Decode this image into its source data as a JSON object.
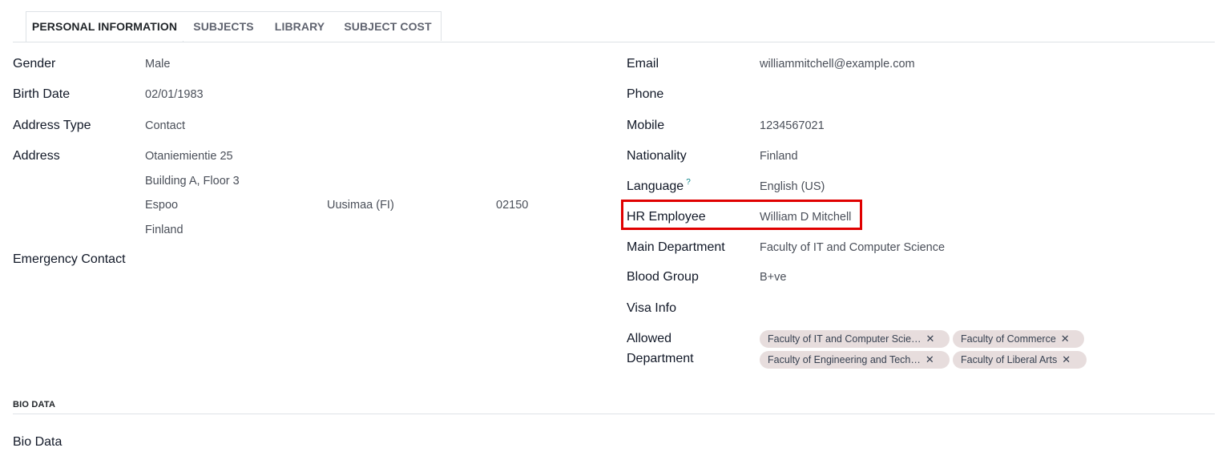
{
  "tabs": [
    {
      "label": "PERSONAL INFORMATION"
    },
    {
      "label": "SUBJECTS"
    },
    {
      "label": "LIBRARY"
    },
    {
      "label": "SUBJECT COST"
    }
  ],
  "left_fields": {
    "gender": {
      "label": "Gender",
      "value": "Male"
    },
    "birth_date": {
      "label": "Birth Date",
      "value": "02/01/1983"
    },
    "address_type": {
      "label": "Address Type",
      "value": "Contact"
    },
    "address": {
      "label": "Address",
      "street": "Otaniemientie 25",
      "street2": "Building A, Floor 3",
      "city": "Espoo",
      "state": "Uusimaa (FI)",
      "zip": "02150",
      "country": "Finland"
    },
    "emergency_contact": {
      "label": "Emergency Contact",
      "value": ""
    }
  },
  "right_fields": {
    "email": {
      "label": "Email",
      "value": "williammitchell@example.com"
    },
    "phone": {
      "label": "Phone",
      "value": ""
    },
    "mobile": {
      "label": "Mobile",
      "value": "1234567021"
    },
    "nationality": {
      "label": "Nationality",
      "value": "Finland"
    },
    "language": {
      "label": "Language",
      "help": "?",
      "value": "English (US)"
    },
    "hr_employee": {
      "label": "HR Employee",
      "value": "William D Mitchell"
    },
    "main_department": {
      "label": "Main Department",
      "value": "Faculty of IT and Computer Science"
    },
    "blood_group": {
      "label": "Blood Group",
      "value": "B+ve"
    },
    "visa_info": {
      "label": "Visa Info",
      "value": ""
    },
    "allowed_department": {
      "label_line1": "Allowed",
      "label_line2": "Department",
      "tags": [
        {
          "label": "Faculty of IT and Computer Scie…"
        },
        {
          "label": "Faculty of Commerce"
        },
        {
          "label": "Faculty of Engineering and Tech…"
        },
        {
          "label": "Faculty of Liberal Arts"
        }
      ],
      "remove_glyph": "✕"
    }
  },
  "bio_section": {
    "title": "BIO DATA",
    "field_label": "Bio Data"
  },
  "colors": {
    "highlight": "#e00000",
    "tag_background": "#e7dddd"
  }
}
